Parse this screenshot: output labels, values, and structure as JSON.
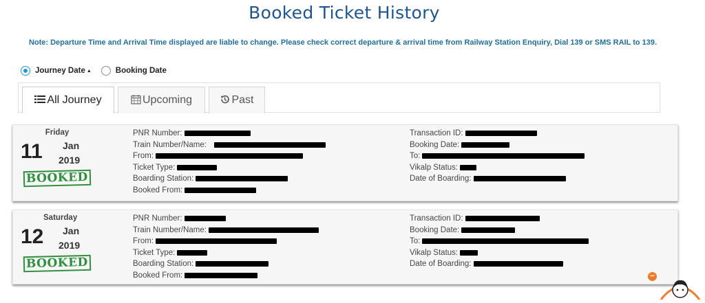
{
  "page": {
    "title": "Booked Ticket History",
    "note": "Note: Departure Time and Arrival Time displayed are liable to change. Please check correct departure & arrival time from Railway Station Enquiry, Dial 139 or SMS RAIL to 139."
  },
  "sort": {
    "options": [
      {
        "label": "Journey Date",
        "selected": true,
        "sort_indicator": "▲"
      },
      {
        "label": "Booking Date",
        "selected": false
      }
    ]
  },
  "tabs": [
    {
      "label": "All Journey",
      "icon": "list-icon",
      "active": true
    },
    {
      "label": "Upcoming",
      "icon": "calendar-icon",
      "active": false
    },
    {
      "label": "Past",
      "icon": "history-icon",
      "active": false
    }
  ],
  "colors": {
    "title": "#1e5590",
    "note": "#1f6fa0",
    "radio_active": "#1b9bd1",
    "booked_stamp": "#2e8f3e",
    "notification": "#f07b2c"
  },
  "tickets": [
    {
      "weekday": "Friday",
      "day": "11",
      "month": "Jan",
      "year": "2019",
      "status": "BOOKED",
      "left_labels": [
        "PNR Number:",
        "Train Number/Name:",
        "From:",
        "Ticket Type:",
        "Boarding Station:",
        "Booked From:"
      ],
      "right_labels": [
        "Transaction ID:",
        "Booking Date:",
        "To:",
        "Vikalp Status:",
        "Date of Boarding:"
      ]
    },
    {
      "weekday": "Saturday",
      "day": "12",
      "month": "Jan",
      "year": "2019",
      "status": "BOOKED",
      "left_labels": [
        "PNR Number:",
        "Train Number/Name:",
        "From:",
        "Ticket Type:",
        "Boarding Station:",
        "Booked From:"
      ],
      "right_labels": [
        "Transaction ID:",
        "Booking Date:",
        "To:",
        "Vikalp Status:",
        "Date of Boarding:"
      ]
    }
  ],
  "notification": {
    "symbol": "−"
  }
}
